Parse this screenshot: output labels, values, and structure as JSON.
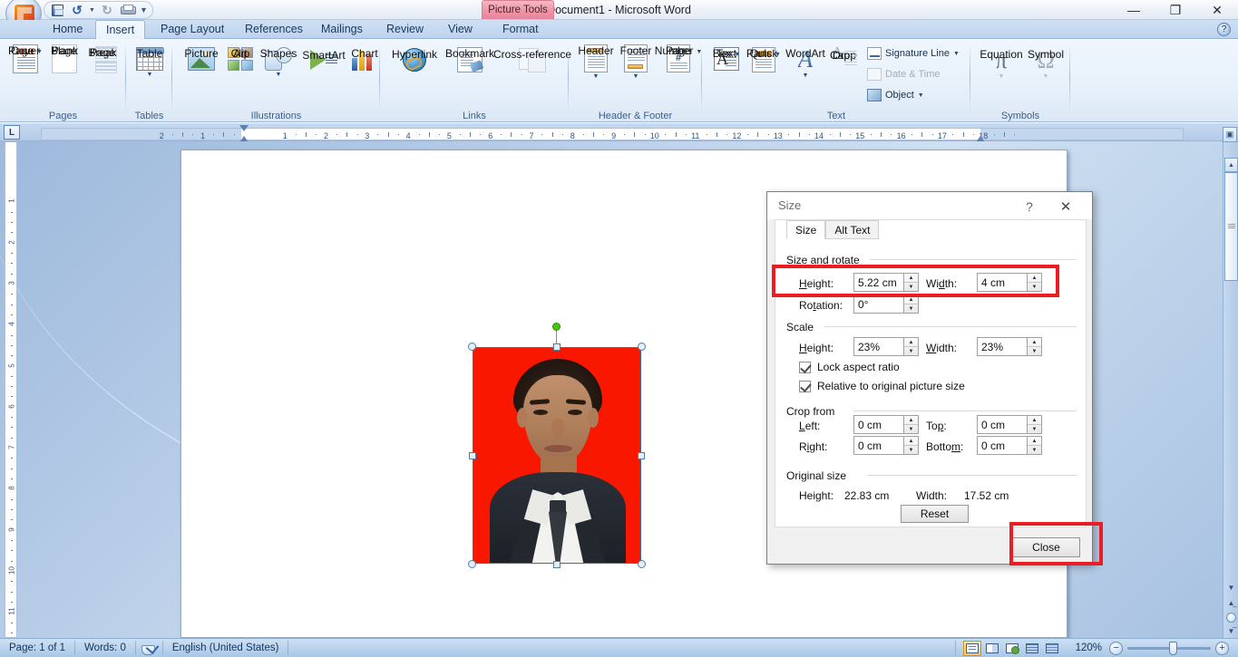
{
  "window": {
    "title": "Document1 - Microsoft Word",
    "contextual_tab": "Picture Tools",
    "minimize": "—",
    "restore": "❐",
    "close": "✕",
    "help": "?"
  },
  "quick_access": {
    "items": [
      {
        "name": "office-button",
        "label": "Office"
      },
      {
        "name": "save",
        "label": "Save"
      },
      {
        "name": "undo",
        "label": "Undo"
      },
      {
        "name": "undo-dropdown",
        "label": "▾"
      },
      {
        "name": "redo",
        "label": "Redo"
      },
      {
        "name": "print-preview",
        "label": "Print Preview"
      },
      {
        "name": "customize-qat",
        "label": "▾"
      }
    ]
  },
  "ribbon": {
    "tabs": [
      {
        "label": "Home",
        "active": false
      },
      {
        "label": "Insert",
        "active": true
      },
      {
        "label": "Page Layout",
        "active": false
      },
      {
        "label": "References",
        "active": false
      },
      {
        "label": "Mailings",
        "active": false
      },
      {
        "label": "Review",
        "active": false
      },
      {
        "label": "View",
        "active": false
      },
      {
        "label": "Format",
        "active": false
      }
    ],
    "groups": [
      {
        "name": "Pages",
        "label": "Pages",
        "buttons": [
          {
            "label": "Cover\nPage",
            "line1": "Cover",
            "line2": "Page",
            "dropdown": true,
            "disabled": false
          },
          {
            "label": "Blank Page",
            "line1": "Blank",
            "line2": "Page",
            "dropdown": false,
            "disabled": true
          },
          {
            "label": "Page Break",
            "line1": "Page",
            "line2": "Break",
            "dropdown": false,
            "disabled": true
          }
        ]
      },
      {
        "name": "Tables",
        "label": "Tables",
        "buttons": [
          {
            "label": "Table",
            "line1": "Table",
            "line2": "",
            "dropdown": true,
            "disabled": false
          }
        ]
      },
      {
        "name": "Illustrations",
        "label": "Illustrations",
        "buttons": [
          {
            "label": "Picture",
            "line1": "Picture",
            "line2": "",
            "dropdown": false,
            "disabled": false
          },
          {
            "label": "Clip Art",
            "line1": "Clip",
            "line2": "Art",
            "dropdown": false,
            "disabled": false
          },
          {
            "label": "Shapes",
            "line1": "Shapes",
            "line2": "",
            "dropdown": true,
            "disabled": false
          },
          {
            "label": "SmartArt",
            "line1": "SmartArt",
            "line2": "",
            "dropdown": false,
            "disabled": false
          },
          {
            "label": "Chart",
            "line1": "Chart",
            "line2": "",
            "dropdown": false,
            "disabled": false
          }
        ]
      },
      {
        "name": "Links",
        "label": "Links",
        "buttons": [
          {
            "label": "Hyperlink",
            "line1": "Hyperlink",
            "line2": "",
            "dropdown": false,
            "disabled": false
          },
          {
            "label": "Bookmark",
            "line1": "Bookmark",
            "line2": "",
            "dropdown": false,
            "disabled": false
          },
          {
            "label": "Cross-reference",
            "line1": "Cross-reference",
            "line2": "",
            "dropdown": false,
            "disabled": true
          }
        ]
      },
      {
        "name": "Header & Footer",
        "label": "Header & Footer",
        "buttons": [
          {
            "label": "Header",
            "line1": "Header",
            "line2": "",
            "dropdown": true,
            "disabled": false
          },
          {
            "label": "Footer",
            "line1": "Footer",
            "line2": "",
            "dropdown": true,
            "disabled": false
          },
          {
            "label": "Page Number",
            "line1": "Page",
            "line2": "Number",
            "dropdown": true,
            "disabled": false
          }
        ]
      },
      {
        "name": "Text",
        "label": "Text",
        "buttons": [
          {
            "label": "Text Box",
            "line1": "Text",
            "line2": "Box",
            "dropdown": true,
            "disabled": false
          },
          {
            "label": "Quick Parts",
            "line1": "Quick",
            "line2": "Parts",
            "dropdown": true,
            "disabled": false
          },
          {
            "label": "WordArt",
            "line1": "WordArt",
            "line2": "",
            "dropdown": true,
            "disabled": false
          },
          {
            "label": "Drop Cap",
            "line1": "Drop",
            "line2": "Cap",
            "dropdown": true,
            "disabled": true
          }
        ],
        "small_buttons": [
          {
            "label": "Signature Line",
            "dropdown": true,
            "disabled": false
          },
          {
            "label": "Date & Time",
            "dropdown": false,
            "disabled": true
          },
          {
            "label": "Object",
            "dropdown": true,
            "disabled": false
          }
        ]
      },
      {
        "name": "Symbols",
        "label": "Symbols",
        "buttons": [
          {
            "label": "Equation",
            "line1": "Equation",
            "line2": "",
            "dropdown": true,
            "disabled": true
          },
          {
            "label": "Symbol",
            "line1": "Symbol",
            "line2": "",
            "dropdown": true,
            "disabled": true
          }
        ]
      }
    ]
  },
  "ruler": {
    "tab_stop_button": "L",
    "horizontal_ticks": [
      "2",
      "1",
      "1",
      "2",
      "3",
      "4",
      "5",
      "6",
      "7",
      "8",
      "9",
      "10",
      "11",
      "12",
      "13",
      "14",
      "15",
      "16",
      "17",
      "18"
    ],
    "vertical_ticks": [
      "1",
      "2",
      "3",
      "4",
      "5",
      "6",
      "7",
      "8",
      "9",
      "10",
      "11"
    ]
  },
  "dialog": {
    "title": "Size",
    "help_glyph": "?",
    "close_glyph": "✕",
    "tabs": [
      {
        "label": "Size",
        "active": true
      },
      {
        "label": "Alt Text",
        "active": false
      }
    ],
    "size_and_rotate": {
      "group_label": "Size and rotate",
      "height_label": "Height:",
      "height_value": "5.22 cm",
      "width_label": "Width:",
      "width_value": "4 cm",
      "rotation_label": "Rotation:",
      "rotation_value": "0°"
    },
    "scale": {
      "group_label": "Scale",
      "height_label": "Height:",
      "height_value": "23%",
      "width_label": "Width:",
      "width_value": "23%",
      "lock_aspect_label": "Lock aspect ratio",
      "lock_aspect_checked": true,
      "relative_label": "Relative to original picture size",
      "relative_checked": true
    },
    "crop_from": {
      "group_label": "Crop from",
      "left_label": "Left:",
      "left_value": "0 cm",
      "top_label": "Top:",
      "top_value": "0 cm",
      "right_label": "Right:",
      "right_value": "0 cm",
      "bottom_label": "Bottom:",
      "bottom_value": "0 cm"
    },
    "original_size": {
      "group_label": "Original size",
      "height_label": "Height:",
      "height_value": "22.83 cm",
      "width_label": "Width:",
      "width_value": "17.52 cm",
      "reset_label": "Reset"
    },
    "close_button_label": "Close",
    "spinner_up": "▲",
    "spinner_down": "▼"
  },
  "highlight": {
    "color": "#ec1c24"
  },
  "status_bar": {
    "page": "Page: 1 of 1",
    "words": "Words: 0",
    "language": "English (United States)",
    "view_buttons": [
      {
        "name": "print-layout",
        "label": "Print Layout",
        "active": true
      },
      {
        "name": "full-screen-reading",
        "label": "Full Screen Reading",
        "active": false
      },
      {
        "name": "web-layout",
        "label": "Web Layout",
        "active": false
      },
      {
        "name": "outline",
        "label": "Outline",
        "active": false
      },
      {
        "name": "draft",
        "label": "Draft",
        "active": false
      }
    ],
    "zoom_level": "120%",
    "zoom_out": "−",
    "zoom_in": "+"
  },
  "document": {
    "image_alt": "Portrait photo on red background"
  }
}
